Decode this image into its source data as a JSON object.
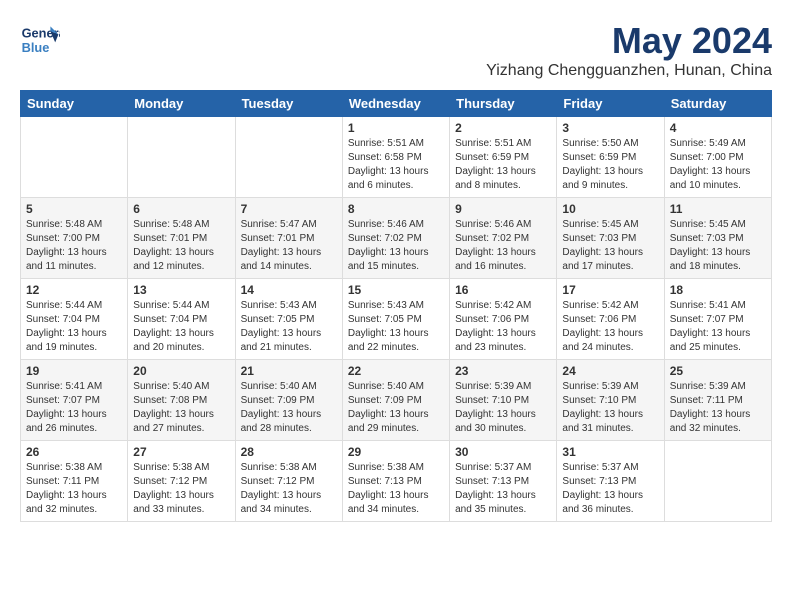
{
  "header": {
    "logo_line1": "General",
    "logo_line2": "Blue",
    "month_year": "May 2024",
    "location": "Yizhang Chengguanzhen, Hunan, China"
  },
  "weekdays": [
    "Sunday",
    "Monday",
    "Tuesday",
    "Wednesday",
    "Thursday",
    "Friday",
    "Saturday"
  ],
  "weeks": [
    [
      {
        "day": "",
        "info": ""
      },
      {
        "day": "",
        "info": ""
      },
      {
        "day": "",
        "info": ""
      },
      {
        "day": "1",
        "info": "Sunrise: 5:51 AM\nSunset: 6:58 PM\nDaylight: 13 hours\nand 6 minutes."
      },
      {
        "day": "2",
        "info": "Sunrise: 5:51 AM\nSunset: 6:59 PM\nDaylight: 13 hours\nand 8 minutes."
      },
      {
        "day": "3",
        "info": "Sunrise: 5:50 AM\nSunset: 6:59 PM\nDaylight: 13 hours\nand 9 minutes."
      },
      {
        "day": "4",
        "info": "Sunrise: 5:49 AM\nSunset: 7:00 PM\nDaylight: 13 hours\nand 10 minutes."
      }
    ],
    [
      {
        "day": "5",
        "info": "Sunrise: 5:48 AM\nSunset: 7:00 PM\nDaylight: 13 hours\nand 11 minutes."
      },
      {
        "day": "6",
        "info": "Sunrise: 5:48 AM\nSunset: 7:01 PM\nDaylight: 13 hours\nand 12 minutes."
      },
      {
        "day": "7",
        "info": "Sunrise: 5:47 AM\nSunset: 7:01 PM\nDaylight: 13 hours\nand 14 minutes."
      },
      {
        "day": "8",
        "info": "Sunrise: 5:46 AM\nSunset: 7:02 PM\nDaylight: 13 hours\nand 15 minutes."
      },
      {
        "day": "9",
        "info": "Sunrise: 5:46 AM\nSunset: 7:02 PM\nDaylight: 13 hours\nand 16 minutes."
      },
      {
        "day": "10",
        "info": "Sunrise: 5:45 AM\nSunset: 7:03 PM\nDaylight: 13 hours\nand 17 minutes."
      },
      {
        "day": "11",
        "info": "Sunrise: 5:45 AM\nSunset: 7:03 PM\nDaylight: 13 hours\nand 18 minutes."
      }
    ],
    [
      {
        "day": "12",
        "info": "Sunrise: 5:44 AM\nSunset: 7:04 PM\nDaylight: 13 hours\nand 19 minutes."
      },
      {
        "day": "13",
        "info": "Sunrise: 5:44 AM\nSunset: 7:04 PM\nDaylight: 13 hours\nand 20 minutes."
      },
      {
        "day": "14",
        "info": "Sunrise: 5:43 AM\nSunset: 7:05 PM\nDaylight: 13 hours\nand 21 minutes."
      },
      {
        "day": "15",
        "info": "Sunrise: 5:43 AM\nSunset: 7:05 PM\nDaylight: 13 hours\nand 22 minutes."
      },
      {
        "day": "16",
        "info": "Sunrise: 5:42 AM\nSunset: 7:06 PM\nDaylight: 13 hours\nand 23 minutes."
      },
      {
        "day": "17",
        "info": "Sunrise: 5:42 AM\nSunset: 7:06 PM\nDaylight: 13 hours\nand 24 minutes."
      },
      {
        "day": "18",
        "info": "Sunrise: 5:41 AM\nSunset: 7:07 PM\nDaylight: 13 hours\nand 25 minutes."
      }
    ],
    [
      {
        "day": "19",
        "info": "Sunrise: 5:41 AM\nSunset: 7:07 PM\nDaylight: 13 hours\nand 26 minutes."
      },
      {
        "day": "20",
        "info": "Sunrise: 5:40 AM\nSunset: 7:08 PM\nDaylight: 13 hours\nand 27 minutes."
      },
      {
        "day": "21",
        "info": "Sunrise: 5:40 AM\nSunset: 7:09 PM\nDaylight: 13 hours\nand 28 minutes."
      },
      {
        "day": "22",
        "info": "Sunrise: 5:40 AM\nSunset: 7:09 PM\nDaylight: 13 hours\nand 29 minutes."
      },
      {
        "day": "23",
        "info": "Sunrise: 5:39 AM\nSunset: 7:10 PM\nDaylight: 13 hours\nand 30 minutes."
      },
      {
        "day": "24",
        "info": "Sunrise: 5:39 AM\nSunset: 7:10 PM\nDaylight: 13 hours\nand 31 minutes."
      },
      {
        "day": "25",
        "info": "Sunrise: 5:39 AM\nSunset: 7:11 PM\nDaylight: 13 hours\nand 32 minutes."
      }
    ],
    [
      {
        "day": "26",
        "info": "Sunrise: 5:38 AM\nSunset: 7:11 PM\nDaylight: 13 hours\nand 32 minutes."
      },
      {
        "day": "27",
        "info": "Sunrise: 5:38 AM\nSunset: 7:12 PM\nDaylight: 13 hours\nand 33 minutes."
      },
      {
        "day": "28",
        "info": "Sunrise: 5:38 AM\nSunset: 7:12 PM\nDaylight: 13 hours\nand 34 minutes."
      },
      {
        "day": "29",
        "info": "Sunrise: 5:38 AM\nSunset: 7:13 PM\nDaylight: 13 hours\nand 34 minutes."
      },
      {
        "day": "30",
        "info": "Sunrise: 5:37 AM\nSunset: 7:13 PM\nDaylight: 13 hours\nand 35 minutes."
      },
      {
        "day": "31",
        "info": "Sunrise: 5:37 AM\nSunset: 7:13 PM\nDaylight: 13 hours\nand 36 minutes."
      },
      {
        "day": "",
        "info": ""
      }
    ]
  ]
}
